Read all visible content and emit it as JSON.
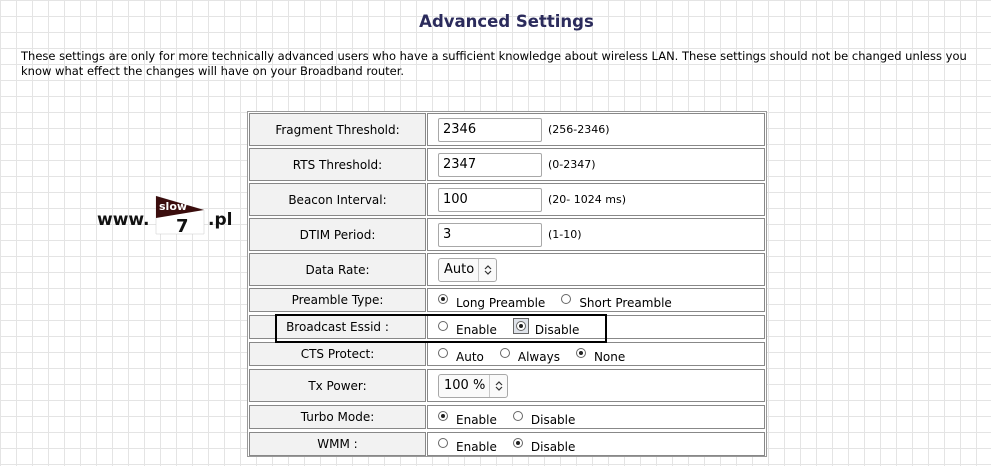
{
  "page": {
    "title": "Advanced Settings",
    "description": "These settings are only for more technically advanced users who have a sufficient knowledge about wireless LAN. These settings should not be changed unless you know what effect the changes will have on your Broadband router."
  },
  "watermark": {
    "prefix": "www.",
    "logo_top": "slow",
    "logo_number": "7",
    "suffix": ".pl"
  },
  "fields": {
    "fragment": {
      "label": "Fragment Threshold:",
      "value": "2346",
      "hint": "(256-2346)"
    },
    "rts": {
      "label": "RTS Threshold:",
      "value": "2347",
      "hint": "(0-2347)"
    },
    "beacon": {
      "label": "Beacon Interval:",
      "value": "100",
      "hint": "(20- 1024 ms)"
    },
    "dtim": {
      "label": "DTIM Period:",
      "value": "3",
      "hint": "(1-10)"
    },
    "data_rate": {
      "label": "Data Rate:",
      "selected": "Auto"
    },
    "preamble": {
      "label": "Preamble Type:",
      "options": [
        "Long Preamble",
        "Short Preamble"
      ],
      "selected": "Long Preamble"
    },
    "broadcast": {
      "label": "Broadcast Essid :",
      "options": [
        "Enable",
        "Disable"
      ],
      "selected": "Disable"
    },
    "cts": {
      "label": "CTS Protect:",
      "options": [
        "Auto",
        "Always",
        "None"
      ],
      "selected": "None"
    },
    "tx_power": {
      "label": "Tx Power:",
      "selected": "100 %"
    },
    "turbo": {
      "label": "Turbo Mode:",
      "options": [
        "Enable",
        "Disable"
      ],
      "selected": "Enable"
    },
    "wmm": {
      "label": "WMM :",
      "options": [
        "Enable",
        "Disable"
      ],
      "selected": "Disable"
    }
  },
  "colors": {
    "title": "#2b2b5c",
    "highlight_border": "#000000",
    "logo_dark": "#3a0d0d"
  }
}
